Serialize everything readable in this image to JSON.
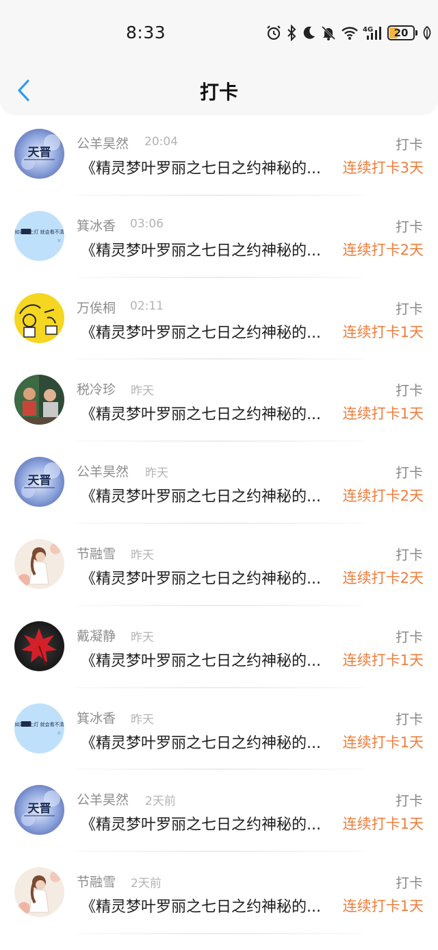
{
  "status_bar": {
    "time": "8:33",
    "battery": "20",
    "icons": [
      "alarm-icon",
      "bluetooth-icon",
      "moon-icon",
      "bell-off-icon",
      "wifi-icon",
      "signal-4g-icon",
      "battery-icon",
      "leaf-icon"
    ],
    "network": "4G"
  },
  "header": {
    "title": "打卡",
    "back_icon": "chevron-left-icon"
  },
  "colors": {
    "accent_blue": "#2b9cf0",
    "streak_orange": "#ee7d3b",
    "battery_fill": "#f2b63a"
  },
  "entries": [
    {
      "user": "公羊昊然",
      "time": "20:04",
      "action": "打卡",
      "book": "《精灵梦叶罗丽之七日之约神秘的...",
      "streak": "连续打卡3天",
      "avatar": "sky-text-avatar",
      "avatar_text": "天晋"
    },
    {
      "user": "箕冰香",
      "time": "03:06",
      "action": "打卡",
      "book": "《精灵梦叶罗丽之七日之约神秘的...",
      "streak": "连续打卡2天",
      "avatar": "blue-text-avatar",
      "avatar_text": "如果关上灯 就会看不清"
    },
    {
      "user": "万俟桐",
      "time": "02:11",
      "action": "打卡",
      "book": "《精灵梦叶罗丽之七日之约神秘的...",
      "streak": "连续打卡1天",
      "avatar": "yellow-cartoon-avatar"
    },
    {
      "user": "税冷珍",
      "time": "昨天",
      "action": "打卡",
      "book": "《精灵梦叶罗丽之七日之约神秘的...",
      "streak": "连续打卡1天",
      "avatar": "photo-avatar"
    },
    {
      "user": "公羊昊然",
      "time": "昨天",
      "action": "打卡",
      "book": "《精灵梦叶罗丽之七日之约神秘的...",
      "streak": "连续打卡2天",
      "avatar": "sky-text-avatar",
      "avatar_text": "天晋"
    },
    {
      "user": "节融雪",
      "time": "昨天",
      "action": "打卡",
      "book": "《精灵梦叶罗丽之七日之约神秘的...",
      "streak": "连续打卡2天",
      "avatar": "girl-flowers-avatar"
    },
    {
      "user": "戴凝静",
      "time": "昨天",
      "action": "打卡",
      "book": "《精灵梦叶罗丽之七日之约神秘的...",
      "streak": "连续打卡1天",
      "avatar": "red-leaf-avatar"
    },
    {
      "user": "箕冰香",
      "time": "昨天",
      "action": "打卡",
      "book": "《精灵梦叶罗丽之七日之约神秘的...",
      "streak": "连续打卡1天",
      "avatar": "blue-text-avatar",
      "avatar_text": "如果关上灯 就会看不清"
    },
    {
      "user": "公羊昊然",
      "time": "2天前",
      "action": "打卡",
      "book": "《精灵梦叶罗丽之七日之约神秘的...",
      "streak": "连续打卡1天",
      "avatar": "sky-text-avatar",
      "avatar_text": "天晋"
    },
    {
      "user": "节融雪",
      "time": "2天前",
      "action": "打卡",
      "book": "《精灵梦叶罗丽之七日之约神秘的...",
      "streak": "连续打卡1天",
      "avatar": "girl-flowers-avatar"
    }
  ]
}
